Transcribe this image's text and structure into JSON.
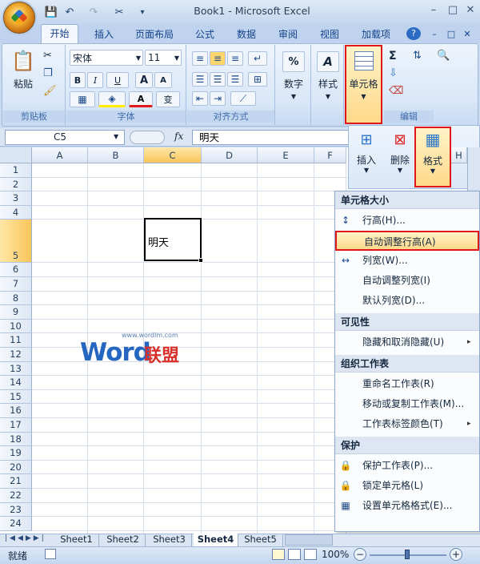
{
  "window": {
    "title": "Book1 - Microsoft Excel",
    "min": "–",
    "max": "□",
    "close": "✕"
  },
  "qat": {
    "save": "💾",
    "undo": "↶",
    "redo": "↷",
    "customize": "▾"
  },
  "tabs": [
    {
      "label": "开始"
    },
    {
      "label": "插入"
    },
    {
      "label": "页面布局"
    },
    {
      "label": "公式"
    },
    {
      "label": "数据"
    },
    {
      "label": "审阅"
    },
    {
      "label": "视图"
    },
    {
      "label": "加载项"
    }
  ],
  "ribbon": {
    "clipboard": {
      "paste": "粘贴",
      "label": "剪贴板"
    },
    "font": {
      "name": "宋体",
      "size": "11",
      "label": "字体",
      "bold": "B",
      "italic": "I",
      "underline": "U",
      "grow": "A",
      "shrink": "A",
      "phonetic": "变"
    },
    "alignment": {
      "label": "对齐方式"
    },
    "number": {
      "label": "数字",
      "symbol": "%"
    },
    "styles": {
      "label": "样式"
    },
    "cells": {
      "label": "单元格"
    },
    "editing": {
      "label": "编辑",
      "sum": "Σ"
    },
    "cells_panel": {
      "insert": "插入",
      "delete": "删除",
      "format": "格式"
    }
  },
  "formula_bar": {
    "name_box": "C5",
    "fx": "fx",
    "content": "明天"
  },
  "sheet": {
    "columns": [
      "A",
      "B",
      "C",
      "D",
      "E",
      "F"
    ],
    "rows": [
      "1",
      "2",
      "3",
      "4",
      "5",
      "6",
      "7",
      "8",
      "9",
      "10",
      "11",
      "12",
      "13",
      "14",
      "15",
      "16",
      "17",
      "18",
      "19",
      "20",
      "21",
      "22",
      "23",
      "24"
    ],
    "active_cell_value": "明天"
  },
  "watermark": {
    "word": "Word",
    "cn": "联盟",
    "url": "www.wordlm.com"
  },
  "menu": {
    "sections": [
      {
        "title": "单元格大小",
        "items": [
          {
            "label": "行高(H)...",
            "icon": "row-height-icon",
            "glyph": "↕"
          },
          {
            "label": "自动调整行高(A)",
            "icon": "",
            "glyph": ""
          },
          {
            "label": "列宽(W)...",
            "icon": "col-width-icon",
            "glyph": "↔"
          },
          {
            "label": "自动调整列宽(I)",
            "icon": "",
            "glyph": ""
          },
          {
            "label": "默认列宽(D)...",
            "icon": "",
            "glyph": ""
          }
        ]
      },
      {
        "title": "可见性",
        "items": [
          {
            "label": "隐藏和取消隐藏(U)",
            "arrow": "▸"
          }
        ]
      },
      {
        "title": "组织工作表",
        "items": [
          {
            "label": "重命名工作表(R)"
          },
          {
            "label": "移动或复制工作表(M)..."
          },
          {
            "label": "工作表标签颜色(T)",
            "arrow": "▸"
          }
        ]
      },
      {
        "title": "保护",
        "items": [
          {
            "label": "保护工作表(P)...",
            "glyph": "🔒"
          },
          {
            "label": "锁定单元格(L)",
            "glyph": "🔒"
          },
          {
            "label": "设置单元格格式(E)...",
            "glyph": "▦"
          }
        ]
      }
    ]
  },
  "sheet_tabs": [
    "Sheet1",
    "Sheet2",
    "Sheet3",
    "Sheet4",
    "Sheet5"
  ],
  "status": {
    "ready": "就绪",
    "zoom": "100%",
    "minus": "−",
    "plus": "+"
  },
  "colors": {
    "highlight": "#e0161b",
    "accent": "#15428b"
  }
}
